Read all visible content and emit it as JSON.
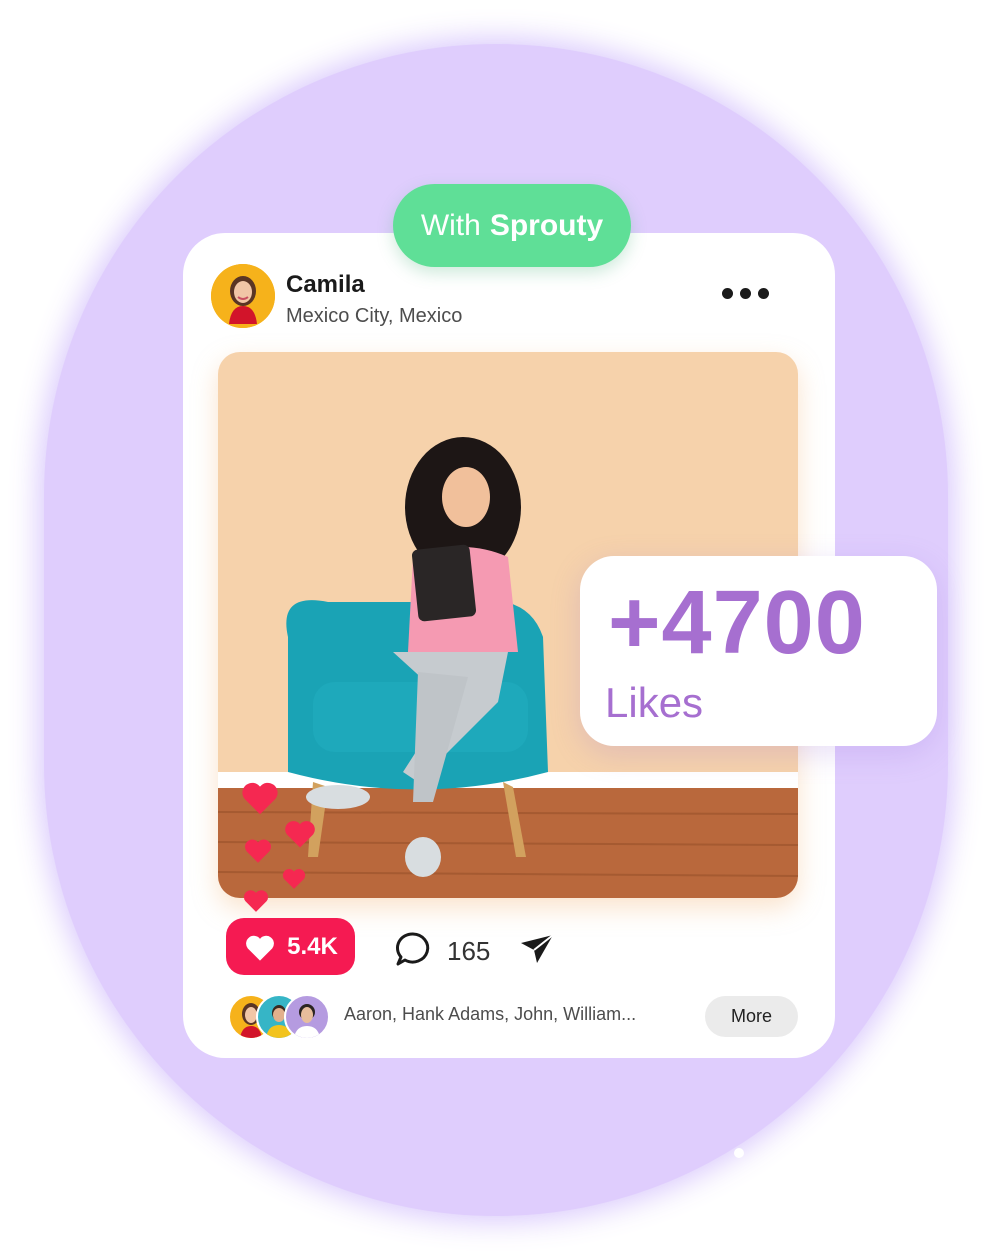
{
  "badge": {
    "prefix": "With",
    "brand": "Sprouty"
  },
  "post": {
    "user_name": "Camila",
    "location": "Mexico City, Mexico",
    "like_count": "5.4K",
    "comment_count": "165"
  },
  "stats_card": {
    "number": "+4700",
    "label": "Likes"
  },
  "likers": {
    "names": "Aaron, Hank Adams, John, William...",
    "more_label": "More"
  },
  "icons": {
    "menu": "more-options-icon",
    "like": "heart-icon",
    "comment": "comment-bubble-icon",
    "share": "send-icon"
  },
  "colors": {
    "background_blob": "#dfcdfd",
    "badge": "#5fdf97",
    "like_button": "#f51a52",
    "stats_text": "#a66fd0"
  }
}
